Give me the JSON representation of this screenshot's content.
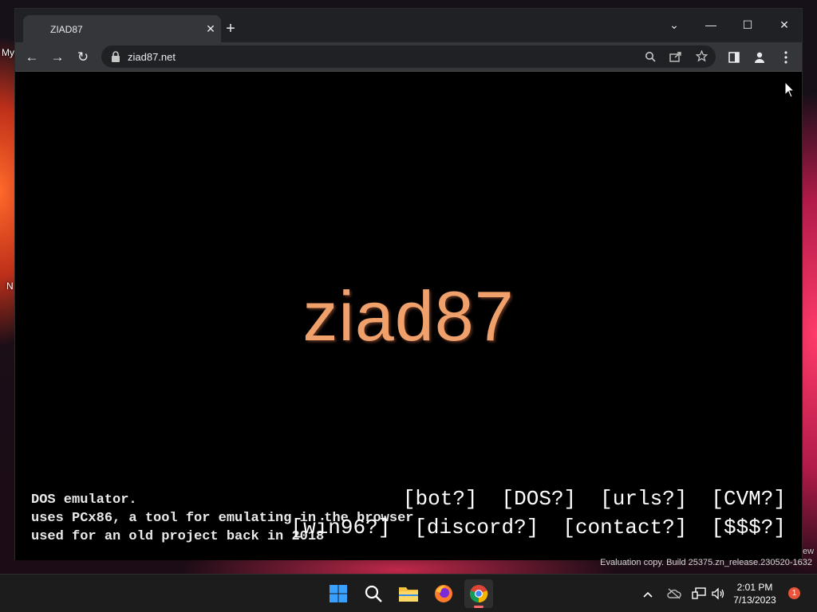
{
  "desktop": {
    "labels": [
      "My",
      "N"
    ]
  },
  "browser": {
    "tab": {
      "title": "ZIAD87",
      "close_glyph": "✕"
    },
    "new_tab_glyph": "+",
    "window_controls": {
      "chevron": "⌄",
      "minimize": "—",
      "maximize": "☐",
      "close": "✕"
    },
    "nav": {
      "back": "←",
      "forward": "→",
      "reload": "↻"
    },
    "url": "ziad87.net",
    "omnibox_icons": [
      "zoom-icon",
      "share-icon",
      "bookmark-star-icon"
    ],
    "toolbar_icons": [
      "side-panel-icon",
      "profile-icon",
      "menu-icon"
    ]
  },
  "page": {
    "logo": "ziad87",
    "info_lines": [
      "DOS emulator.",
      "uses PCx86, a tool for emulating in the browser",
      "used for an old project back in 2018"
    ],
    "links_row1": [
      "[bot?]",
      "[DOS?]",
      "[urls?]",
      "[CVM?]"
    ],
    "links_row2": [
      "[win96?]",
      "[discord?]",
      "[contact?]",
      "[$$$?]"
    ]
  },
  "watermark": {
    "line": "Evaluation copy. Build 25375.zn_release.230520-1632",
    "edge_fragment": "ew"
  },
  "taskbar": {
    "apps": [
      "start-icon",
      "search-icon",
      "file-explorer-icon",
      "firefox-icon",
      "chrome-icon"
    ],
    "tray": [
      "chevron-up-icon",
      "onedrive-icon",
      "network-icon",
      "volume-icon"
    ],
    "clock_time": "2:01 PM",
    "clock_date": "7/13/2023",
    "notification_count": "1"
  },
  "colors": {
    "logo": "#f0a06a",
    "chrome_dark": "#202124",
    "chrome_toolbar": "#35363a",
    "taskbar": "#1c1c1c"
  }
}
